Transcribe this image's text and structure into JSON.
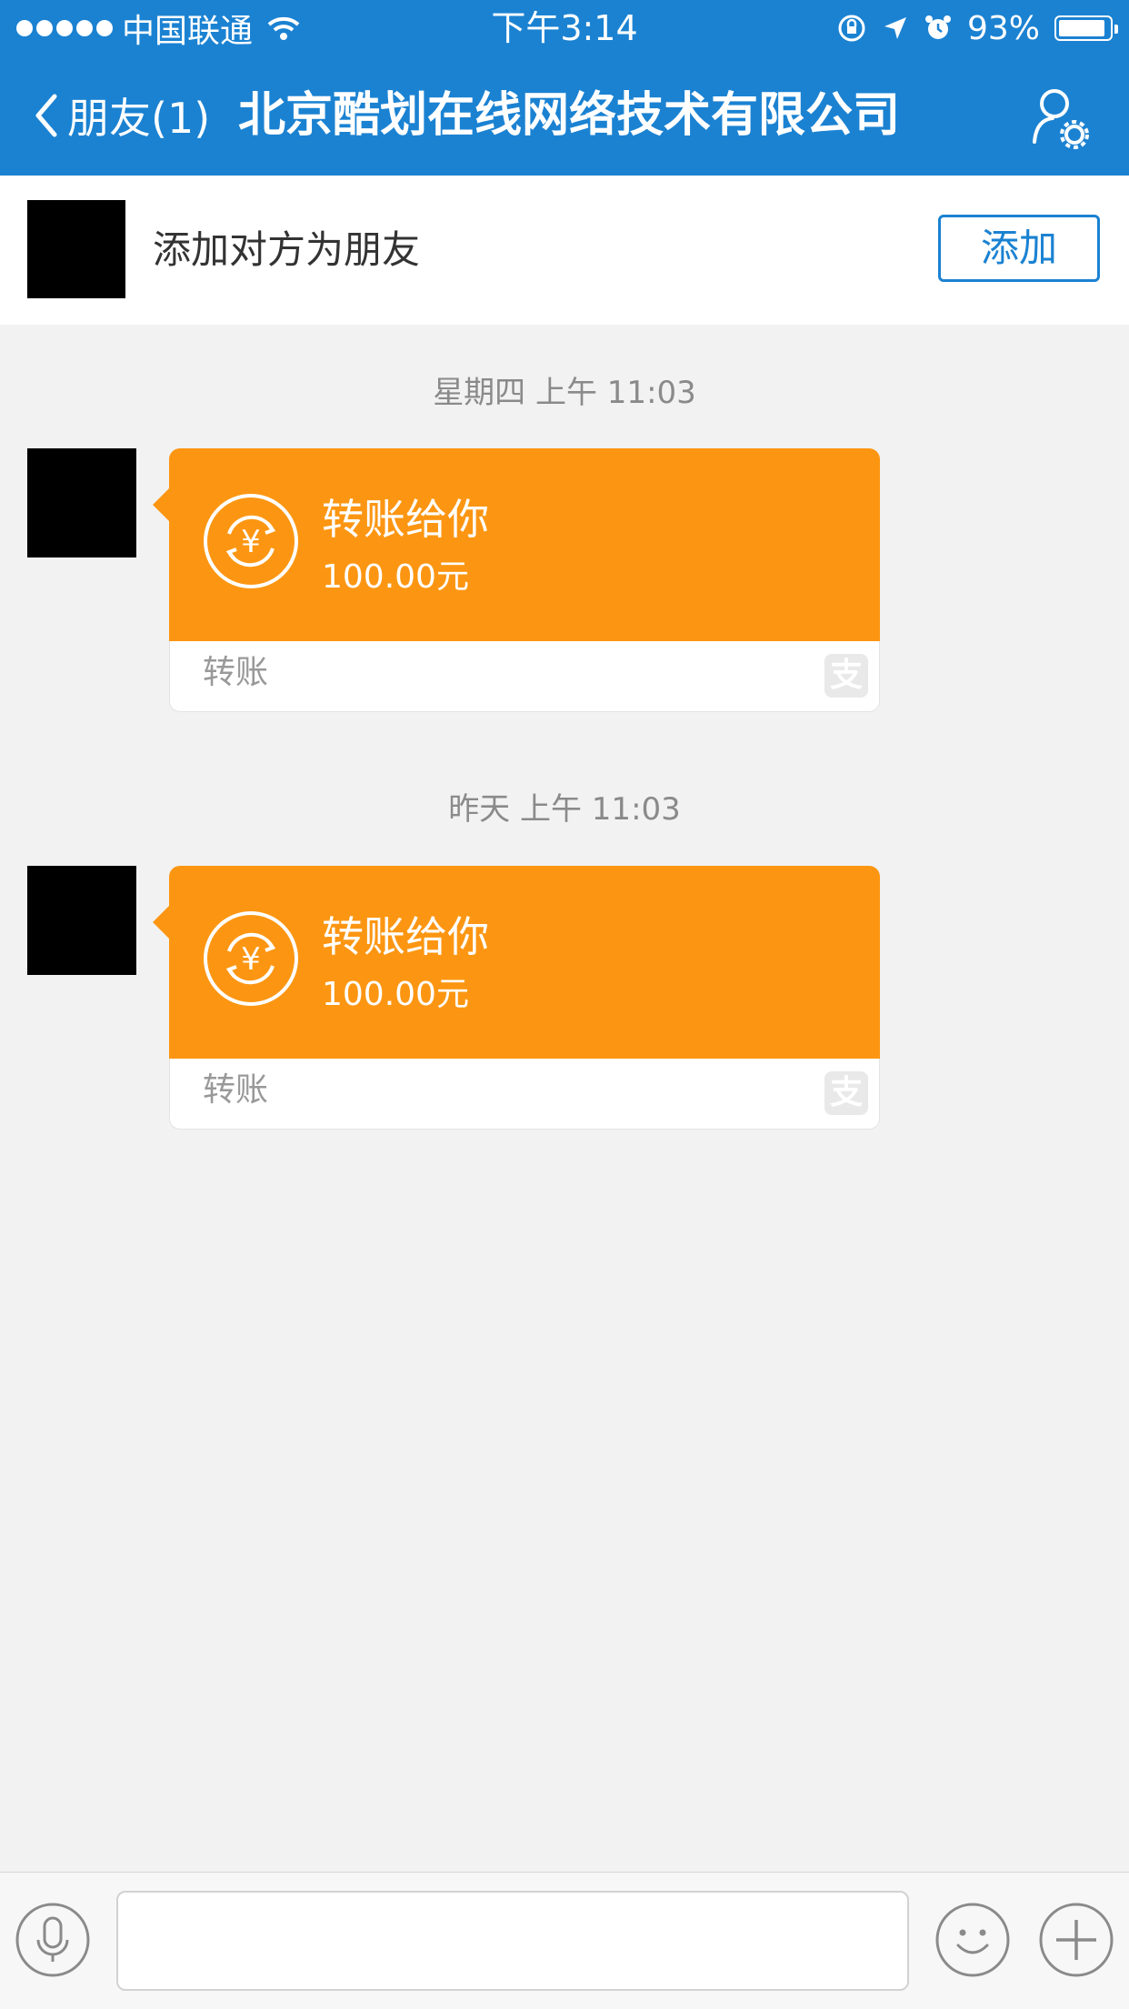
{
  "status_bar": {
    "carrier": "中国联通",
    "time": "下午3:14",
    "battery": "93%",
    "battery_level": 0.93
  },
  "nav": {
    "back_label": "朋友(1)",
    "title": "北京酷划在线网络技术有限公司",
    "settings_icon": "user-settings-icon"
  },
  "add_friend": {
    "text": "添加对方为朋友",
    "button": "添加"
  },
  "messages": [
    {
      "timestamp": "星期四 上午 11:03",
      "title": "转账给你",
      "amount": "100.00元",
      "label": "转账",
      "alipay_glyph": "支"
    },
    {
      "timestamp": "昨天 上午 11:03",
      "title": "转账给你",
      "amount": "100.00元",
      "label": "转账",
      "alipay_glyph": "支"
    }
  ],
  "colors": {
    "nav_blue": "#1b82d2",
    "transfer_orange": "#fc9612",
    "background": "#f2f2f2"
  }
}
